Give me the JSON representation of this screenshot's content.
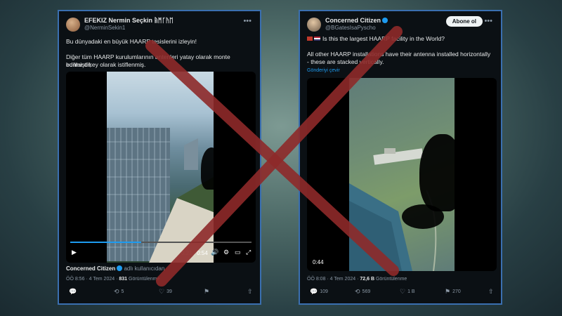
{
  "left_post": {
    "author_name": "EFEKIZ Nermin Seçkin ᚥᛗᚴᚤᛖ",
    "author_handle": "@NerminSekin1",
    "line1": "Bu dünyadaki en büyük HAARP tesislerini izleyin!",
    "line2a": "Diğer tüm HAARP kurulumlarının antenleri yatay olarak monte edilmiştir;",
    "line2b": "bunlar dikey olarak istiflenmiş.",
    "video_time": "0:21 / 0:54",
    "attribution_name": "Concerned Citizen",
    "attribution_suffix": "adlı kullanıcıdan",
    "time": "ÖÖ 8:56 · 4 Tem 2024 ·",
    "views_count": "831",
    "views_label": "Görüntülenme",
    "retweets": "5",
    "likes": "39"
  },
  "right_post": {
    "author_name": "Concerned Citizen",
    "author_handle": "@BGatesIsaPyscho",
    "follow_label": "Abone ol",
    "line1": "Is this the largest HAARP facility in the World?",
    "line2": "All other HAARP installations have their antenna installed horizontally - these are stacked vertically.",
    "translate_label": "Gönderiyi çevir",
    "video_time": "0:44",
    "time": "ÖÖ 8:08 · 4 Tem 2024 ·",
    "views_count": "72,6 B",
    "views_label": "Görüntülenme",
    "replies": "109",
    "retweets": "569",
    "likes": "1 B",
    "bookmarks": "270"
  },
  "icons": {
    "reply": "💬",
    "retweet": "⟲",
    "like": "♡",
    "bookmark": "⚑",
    "share": "⇧"
  },
  "colors": {
    "x_mark": "#8e2a2a",
    "border": "#3a6fb0",
    "verified": "#1d9bf0"
  }
}
